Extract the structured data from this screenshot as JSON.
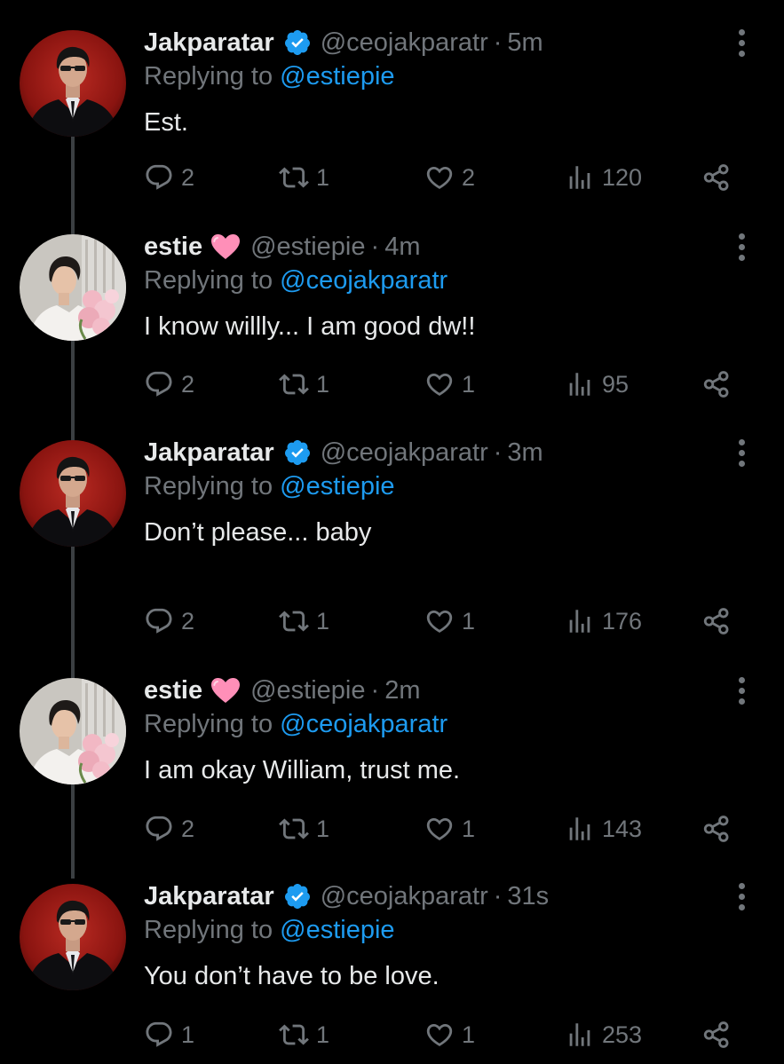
{
  "colors": {
    "background": "#000000",
    "text_primary": "#e7e9ea",
    "text_secondary": "#71767b",
    "link": "#1d9bf0",
    "verified": "#1d9bf0",
    "heart_emoji": "#ff8fb8"
  },
  "reply_prefix": "Replying to",
  "tweets": [
    {
      "name": "Jakparatar",
      "verified": true,
      "handle": "@ceojakparatr",
      "separator": "·",
      "time": "5m",
      "reply_to": "@estiepie",
      "text": "Est.",
      "replies": "2",
      "retweets": "1",
      "likes": "2",
      "views": "120",
      "avatar": "man-in-suit-red-background"
    },
    {
      "name": "estie",
      "name_emoji": "pink-heart-icon",
      "handle": "@estiepie",
      "separator": "·",
      "time": "4m",
      "reply_to": "@ceojakparatr",
      "text": "I know willly... I am good dw!!",
      "replies": "2",
      "retweets": "1",
      "likes": "1",
      "views": "95",
      "avatar": "person-with-pink-flowers"
    },
    {
      "name": "Jakparatar",
      "verified": true,
      "handle": "@ceojakparatr",
      "separator": "·",
      "time": "3m",
      "reply_to": "@estiepie",
      "text": "Don’t please... baby",
      "replies": "2",
      "retweets": "1",
      "likes": "1",
      "views": "176",
      "avatar": "man-in-suit-red-background"
    },
    {
      "name": "estie",
      "name_emoji": "pink-heart-icon",
      "handle": "@estiepie",
      "separator": "·",
      "time": "2m",
      "reply_to": "@ceojakparatr",
      "text": "I am okay William, trust me.",
      "replies": "2",
      "retweets": "1",
      "likes": "1",
      "views": "143",
      "avatar": "person-with-pink-flowers"
    },
    {
      "name": "Jakparatar",
      "verified": true,
      "handle": "@ceojakparatr",
      "separator": "·",
      "time": "31s",
      "reply_to": "@estiepie",
      "text": "You don’t have to be love.",
      "replies": "1",
      "retweets": "1",
      "likes": "1",
      "views": "253",
      "avatar": "man-in-suit-red-background"
    }
  ]
}
